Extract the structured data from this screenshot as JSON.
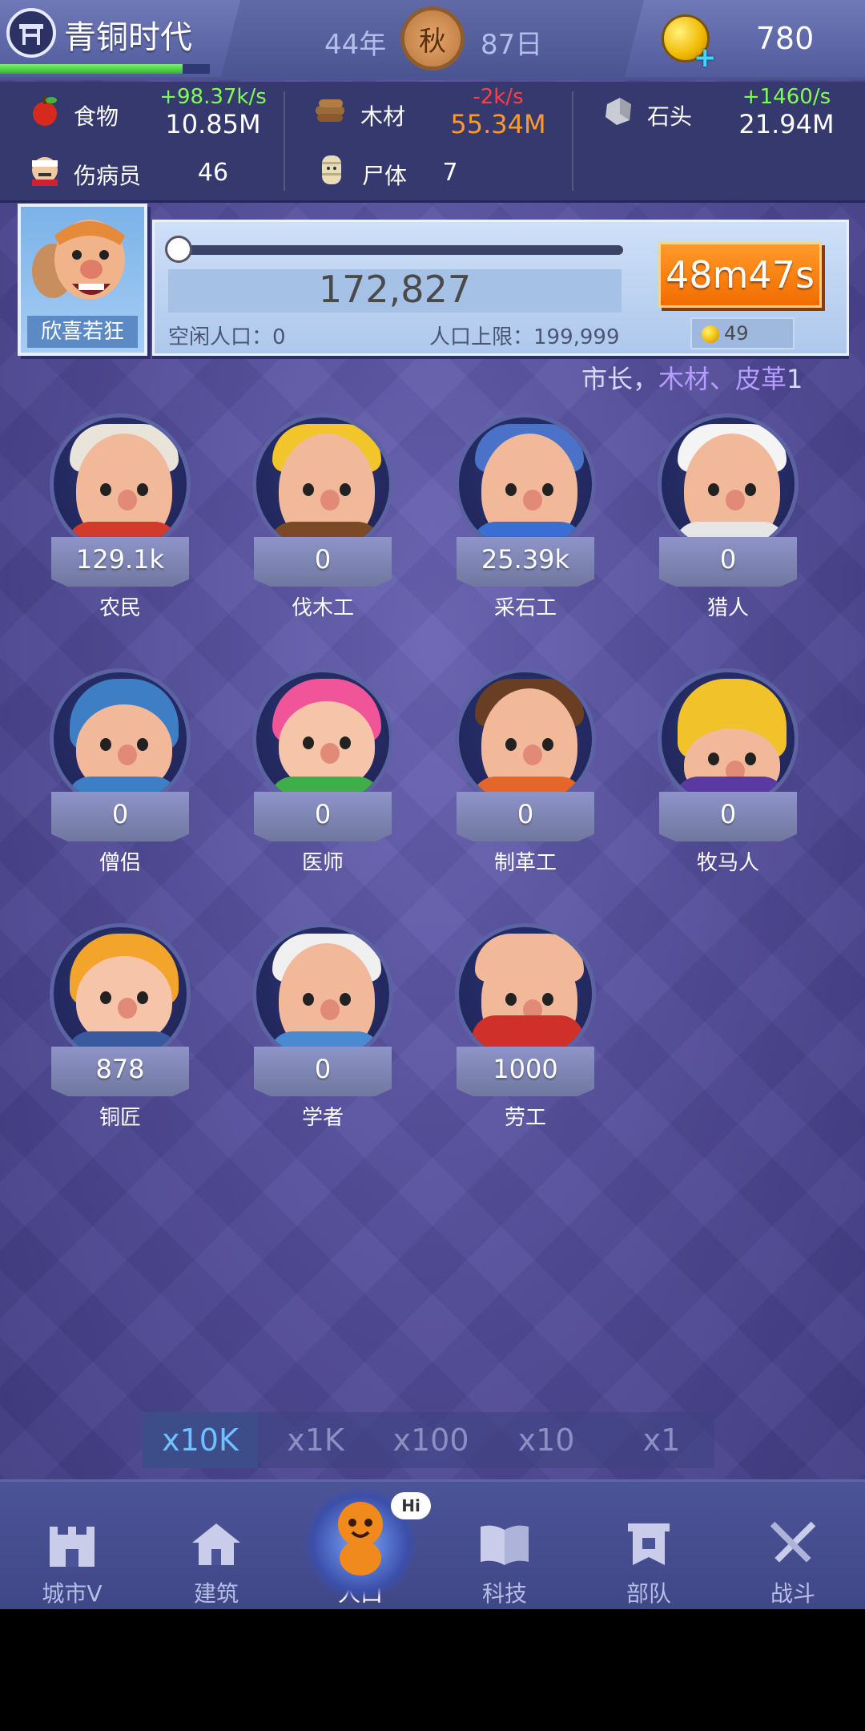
{
  "header": {
    "era_name": "青铜时代",
    "era_progress": 0.87,
    "year": "44年",
    "season": "秋",
    "day": "87日",
    "coins": "780"
  },
  "resources": {
    "food": {
      "name": "食物",
      "rate": "+98.37k/s",
      "value": "10.85M",
      "rate_color": "#7fff55",
      "value_color": "#ffffff"
    },
    "wood": {
      "name": "木材",
      "rate": "-2k/s",
      "value": "55.34M",
      "rate_color": "#ff4040",
      "value_color": "#ff9a2a"
    },
    "stone": {
      "name": "石头",
      "rate": "+1460/s",
      "value": "21.94M",
      "rate_color": "#7fff55",
      "value_color": "#ffffff"
    },
    "wounded": {
      "name": "伤病员",
      "value": "46"
    },
    "corpse": {
      "name": "尸体",
      "value": "7"
    }
  },
  "population": {
    "mood_label": "欣喜若狂",
    "total": "172,827",
    "idle_label": "空闲人口：0",
    "limit_label": "人口上限：199,999",
    "timer": "48m47s",
    "cost": "49",
    "marquee_prefix": "市长，",
    "marquee_highlight": "木材、皮革",
    "marquee_suffix": "1"
  },
  "workers": [
    {
      "name": "农民",
      "count": "129.1k"
    },
    {
      "name": "伐木工",
      "count": "0"
    },
    {
      "name": "采石工",
      "count": "25.39k"
    },
    {
      "name": "猎人",
      "count": "0"
    },
    {
      "name": "僧侣",
      "count": "0"
    },
    {
      "name": "医师",
      "count": "0"
    },
    {
      "name": "制革工",
      "count": "0"
    },
    {
      "name": "牧马人",
      "count": "0"
    },
    {
      "name": "铜匠",
      "count": "878"
    },
    {
      "name": "学者",
      "count": "0"
    },
    {
      "name": "劳工",
      "count": "1000"
    }
  ],
  "multipliers": [
    "x10K",
    "x1K",
    "x100",
    "x10",
    "x1"
  ],
  "nav": [
    {
      "label": "城市V",
      "icon": "castle-icon"
    },
    {
      "label": "建筑",
      "icon": "house-icon"
    },
    {
      "label": "人口",
      "icon": "person-icon",
      "badge": "Hi"
    },
    {
      "label": "科技",
      "icon": "book-icon"
    },
    {
      "label": "部队",
      "icon": "banner-icon"
    },
    {
      "label": "战斗",
      "icon": "swords-icon"
    }
  ]
}
